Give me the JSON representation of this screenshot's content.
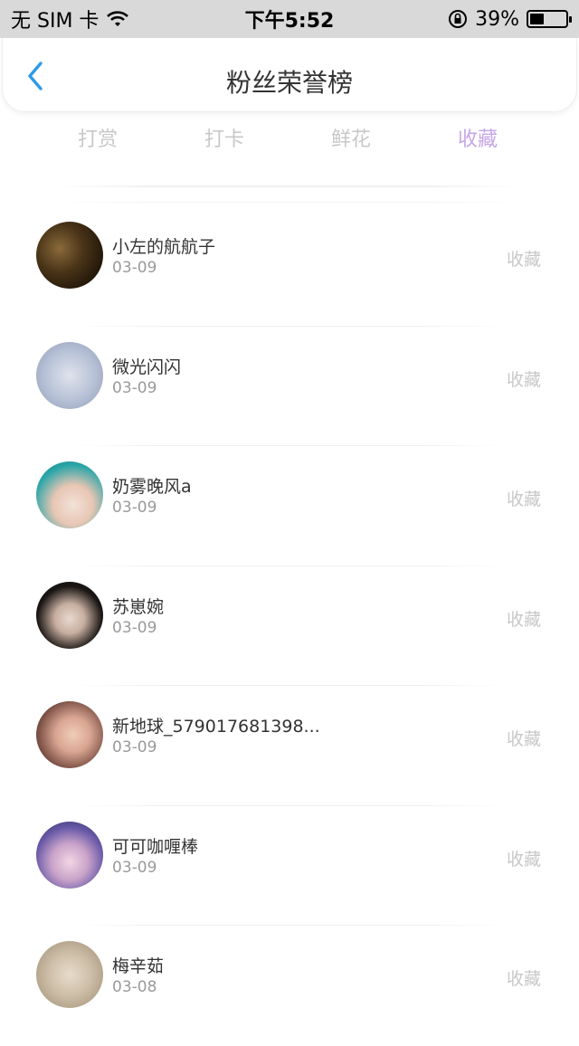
{
  "status_bar": {
    "carrier": "无 SIM 卡",
    "time": "下午5:52",
    "battery": "39%",
    "battery_level": 0.39
  },
  "nav": {
    "title": "粉丝荣誉榜",
    "accent": "#2d9ae8"
  },
  "tabs": [
    {
      "label": "打赏"
    },
    {
      "label": "打卡"
    },
    {
      "label": "鲜花"
    },
    {
      "label": "收藏",
      "active": true
    }
  ],
  "colors": {
    "active_tab": "#c7a6e6",
    "inactive_tab": "#c8c8c8"
  },
  "list": [
    {
      "name": "小左的航航子",
      "date": "03-09",
      "type": "收藏"
    },
    {
      "name": "微光闪闪",
      "date": "03-09",
      "type": "收藏"
    },
    {
      "name": "奶雾晚风a",
      "date": "03-09",
      "type": "收藏"
    },
    {
      "name": "苏崽婉",
      "date": "03-09",
      "type": "收藏"
    },
    {
      "name": "新地球_579017681398...",
      "date": "03-09",
      "type": "收藏"
    },
    {
      "name": "可可咖喱棒",
      "date": "03-09",
      "type": "收藏"
    },
    {
      "name": "梅辛茹",
      "date": "03-08",
      "type": "收藏"
    }
  ]
}
